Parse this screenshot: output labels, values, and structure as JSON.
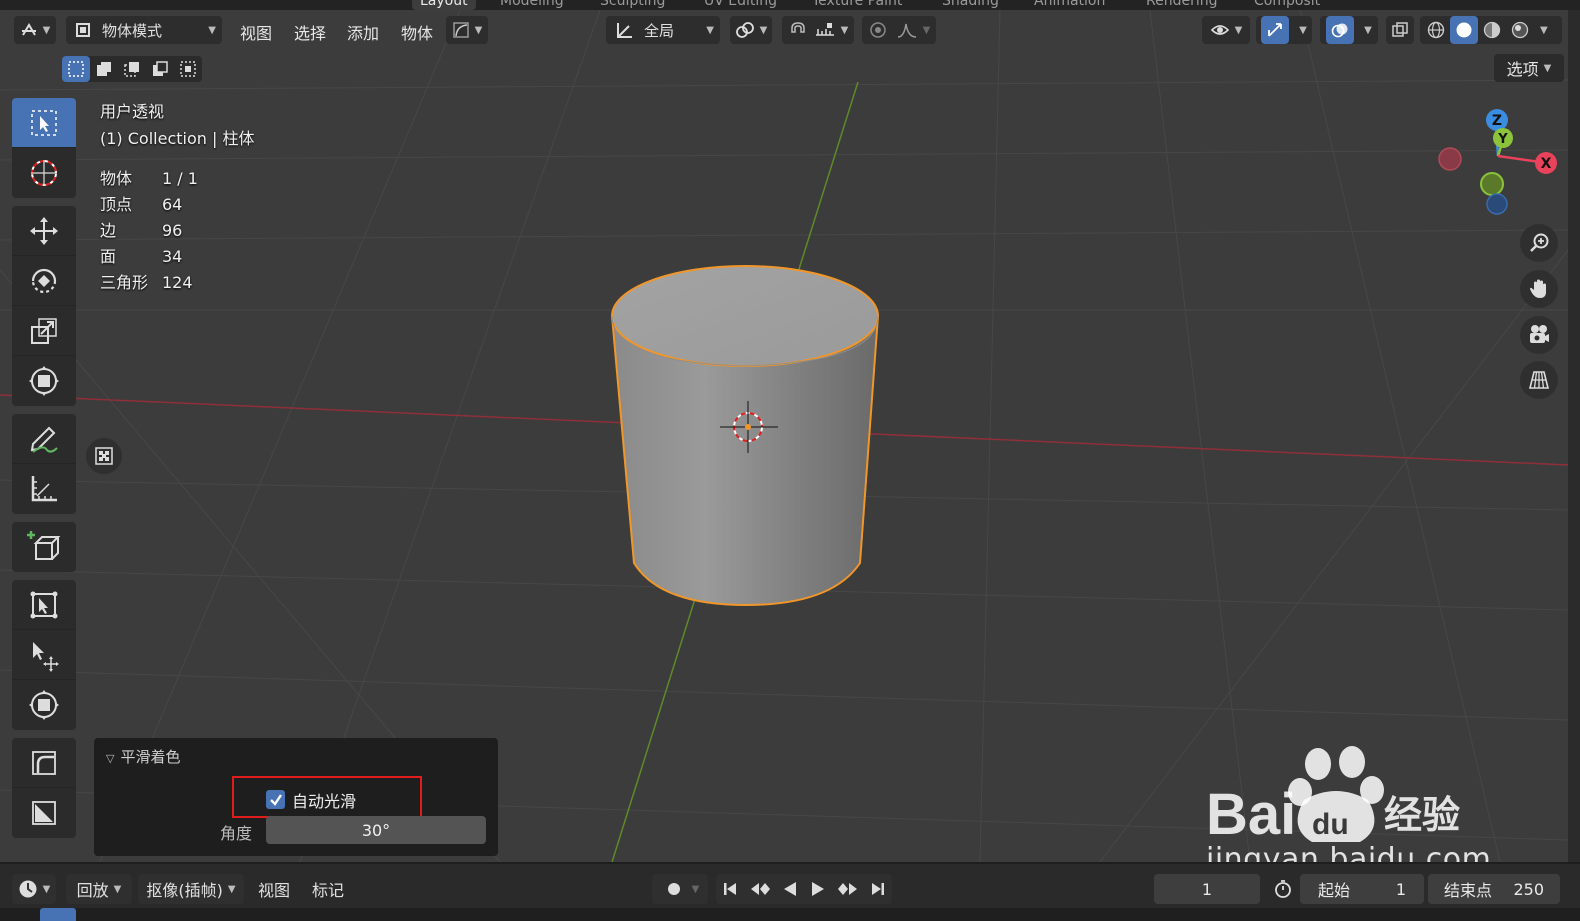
{
  "workspace_tabs": [
    {
      "label": "Layout",
      "active": true
    },
    {
      "label": "Modeling",
      "active": false
    },
    {
      "label": "Sculpting",
      "active": false
    },
    {
      "label": "UV Editing",
      "active": false
    },
    {
      "label": "Texture Paint",
      "active": false
    },
    {
      "label": "Shading",
      "active": false
    },
    {
      "label": "Animation",
      "active": false
    },
    {
      "label": "Rendering",
      "active": false
    },
    {
      "label": "Composit",
      "active": false
    }
  ],
  "header": {
    "mode_label": "物体模式",
    "menus": [
      "视图",
      "选择",
      "添加",
      "物体"
    ],
    "transform_orientation": "全局",
    "options_label": "选项"
  },
  "info": {
    "view_name": "用户透视",
    "collection_line": "(1) Collection | 柱体",
    "stats": [
      {
        "key": "物体",
        "value": "1 / 1"
      },
      {
        "key": "顶点",
        "value": "64"
      },
      {
        "key": "边",
        "value": "96"
      },
      {
        "key": "面",
        "value": "34"
      },
      {
        "key": "三角形",
        "value": "124"
      }
    ]
  },
  "gizmo": {
    "z": "Z",
    "y": "Y",
    "x": "X"
  },
  "operator_panel": {
    "title": "平滑着色",
    "auto_smooth_label": "自动光滑",
    "auto_smooth_checked": true,
    "angle_label": "角度",
    "angle_value": "30°"
  },
  "timeline": {
    "playback": "回放",
    "keying": "抠像(插帧)",
    "view": "视图",
    "marker": "标记",
    "current_frame": "1",
    "start_label": "起始",
    "start_value": "1",
    "end_label": "结束点",
    "end_value": "250"
  },
  "watermark": {
    "brand": "Bai",
    "brand_du": "du",
    "brand_cn": "经验",
    "url": "jingyan.baidu.com"
  },
  "colors": {
    "accent": "#4772b3",
    "selection_outline": "#f0962a",
    "highlight_box": "#e01c1c",
    "x_axis": "#e8435a",
    "y_axis": "#8bc33a",
    "z_axis": "#3a8de0"
  }
}
